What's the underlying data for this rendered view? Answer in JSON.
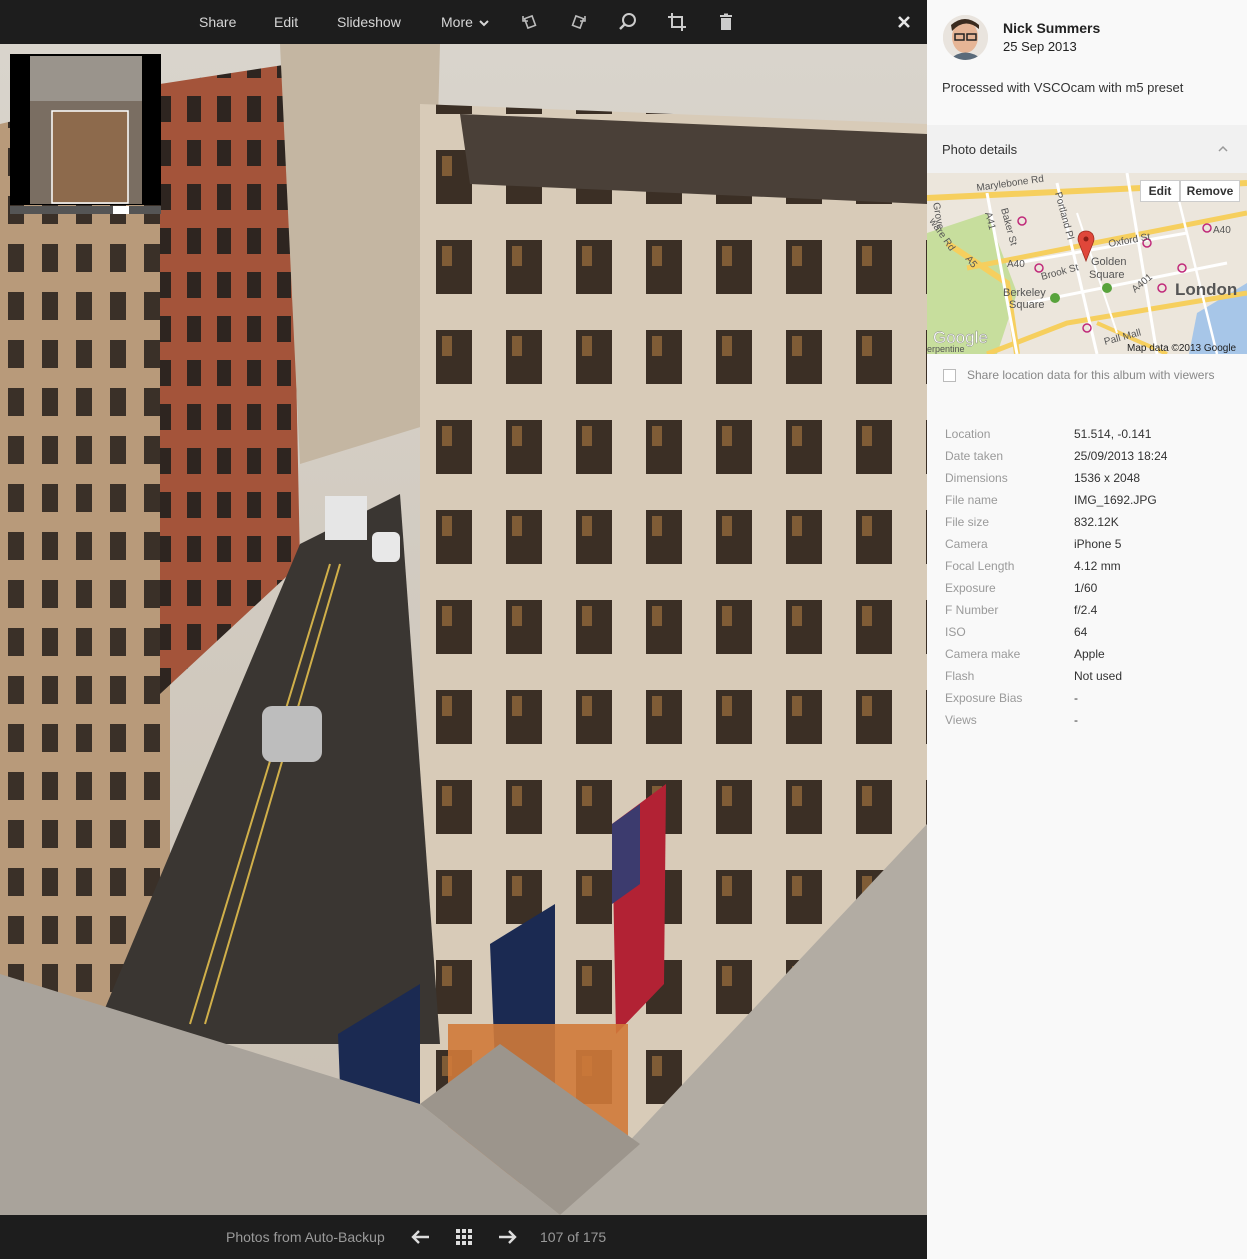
{
  "toolbar": {
    "share": "Share",
    "edit": "Edit",
    "slideshow": "Slideshow",
    "more": "More"
  },
  "bottombar": {
    "album": "Photos from Auto-Backup",
    "counter": "107 of 175"
  },
  "author": {
    "name": "Nick Summers",
    "date": "25 Sep 2013"
  },
  "caption": "Processed with VSCOcam with m5 preset",
  "photo_details": {
    "title": "Photo details"
  },
  "map": {
    "edit": "Edit",
    "remove": "Remove",
    "attribution": "Map data ©2013 Google",
    "logo": "Google",
    "labels": {
      "marylebone": "Marylebone Rd",
      "portland": "Portland Pl",
      "baker": "Baker St",
      "oxford": "Oxford St",
      "a41": "A41",
      "a40a": "A40",
      "a40b": "A40",
      "a5": "A5",
      "a401": "A401",
      "brook": "Brook St",
      "golden1": "Golden",
      "golden2": "Square",
      "berkeley1": "Berkeley",
      "berkeley2": "Square",
      "london": "London",
      "pallmall": "Pall Mall",
      "grove": "Grove",
      "edgware": "ware Rd",
      "serpentine": "erpentine"
    }
  },
  "share_location": {
    "label": "Share location data for this album with viewers",
    "checked": false
  },
  "details": [
    {
      "label": "Location",
      "value": "51.514, -0.141"
    },
    {
      "label": "Date taken",
      "value": "25/09/2013 18:24"
    },
    {
      "label": "Dimensions",
      "value": "1536 x 2048"
    },
    {
      "label": "File name",
      "value": "IMG_1692.JPG"
    },
    {
      "label": "File size",
      "value": "832.12K"
    },
    {
      "label": "Camera",
      "value": "iPhone 5"
    },
    {
      "label": "Focal Length",
      "value": "4.12 mm"
    },
    {
      "label": "Exposure",
      "value": "1/60"
    },
    {
      "label": "F Number",
      "value": "f/2.4"
    },
    {
      "label": "ISO",
      "value": "64"
    },
    {
      "label": "Camera make",
      "value": "Apple"
    },
    {
      "label": "Flash",
      "value": "Not used"
    },
    {
      "label": "Exposure Bias",
      "value": "-"
    },
    {
      "label": "Views",
      "value": "-"
    }
  ],
  "colors": {
    "toolbar_bg": "#1d1d1d",
    "panel_bg": "#f9f9f9",
    "map_pin": "#e0473a"
  },
  "icons": {
    "rotate_left": "rotate-left-icon",
    "rotate_right": "rotate-right-icon",
    "zoom": "zoom-icon",
    "crop": "crop-icon",
    "delete": "trash-icon",
    "close": "close-icon",
    "prev": "arrow-left-icon",
    "grid": "grid-icon",
    "next": "arrow-right-icon"
  }
}
